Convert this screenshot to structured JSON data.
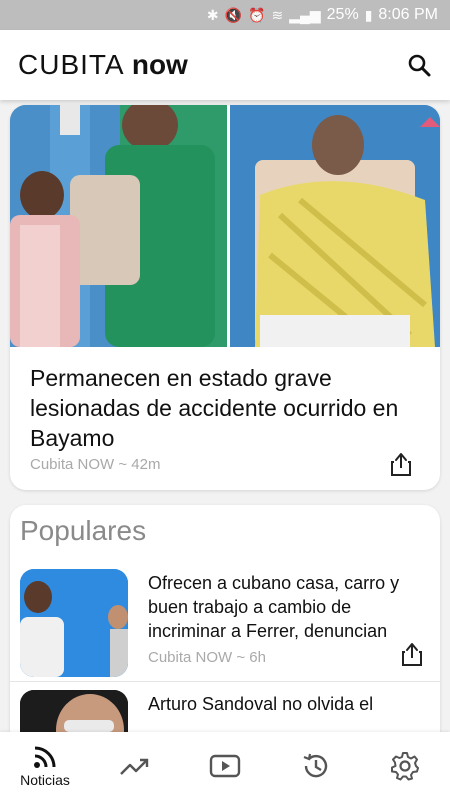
{
  "status_bar": {
    "battery": "25%",
    "time": "8:06 PM",
    "icons": [
      "bluetooth-icon",
      "mute-icon",
      "alarm-icon",
      "wifi-icon",
      "signal-icon",
      "battery-icon"
    ]
  },
  "app": {
    "logo_light": "CUBITA ",
    "logo_bold": "now"
  },
  "hero": {
    "title": "Permanecen en estado grave lesionadas de accidente ocurrido en Bayamo",
    "meta": "Cubita NOW ~ 42m"
  },
  "popular": {
    "heading": "Populares",
    "items": [
      {
        "title": "Ofrecen a cubano casa, carro y buen trabajo a cambio de incriminar a Ferrer, denuncian",
        "meta": "Cubita NOW ~ 6h"
      },
      {
        "title": "Arturo Sandoval no olvida el",
        "meta": ""
      }
    ]
  },
  "nav": {
    "items": [
      {
        "label": "Noticias",
        "icon": "rss-icon",
        "active": true
      },
      {
        "label": "",
        "icon": "trending-icon"
      },
      {
        "label": "",
        "icon": "video-icon"
      },
      {
        "label": "",
        "icon": "history-icon"
      },
      {
        "label": "",
        "icon": "gear-icon"
      }
    ]
  },
  "colors": {
    "accent": "#111111",
    "meta_gray": "#a9a9a9",
    "status_bar": "#bdbdbd"
  }
}
